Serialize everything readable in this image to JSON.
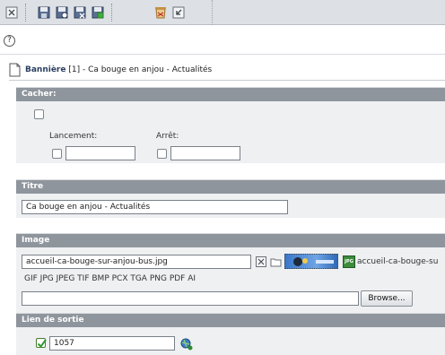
{
  "toolbar": {
    "icons": [
      "close-icon",
      "save-icon",
      "save-view-icon",
      "save-close-icon",
      "save-new-icon",
      "delete-icon",
      "undo-icon"
    ]
  },
  "helpbar": {
    "icon": "help-icon",
    "glyph": "?"
  },
  "record": {
    "table_name": "Bannière",
    "details": " [1] - Ca bouge en anjou - Actualités"
  },
  "sections": {
    "hide": {
      "title": "Cacher:",
      "launch_label": "Lancement:",
      "stop_label": "Arrêt:",
      "launch_value": "",
      "stop_value": ""
    },
    "title": {
      "title": "Titre",
      "value": "Ca bouge en anjou - Actualités"
    },
    "image": {
      "title": "Image",
      "filename": "accueil-ca-bouge-sur-anjou-bus.jpg",
      "file_label": "accueil-ca-bouge-su",
      "allowed_types": "GIF JPG JPEG TIF BMP PCX TGA PNG PDF AI",
      "upload_value": "",
      "browse_label": "Browse...",
      "badge": "JPG"
    },
    "link": {
      "title": "Lien de sortie",
      "value": "1057",
      "checked": true
    }
  },
  "colors": {
    "section_header": "#8f959d",
    "section_body": "#eef0f2",
    "title_accent": "#2a3f5f",
    "toolbar_bg": "#dde0e4"
  }
}
